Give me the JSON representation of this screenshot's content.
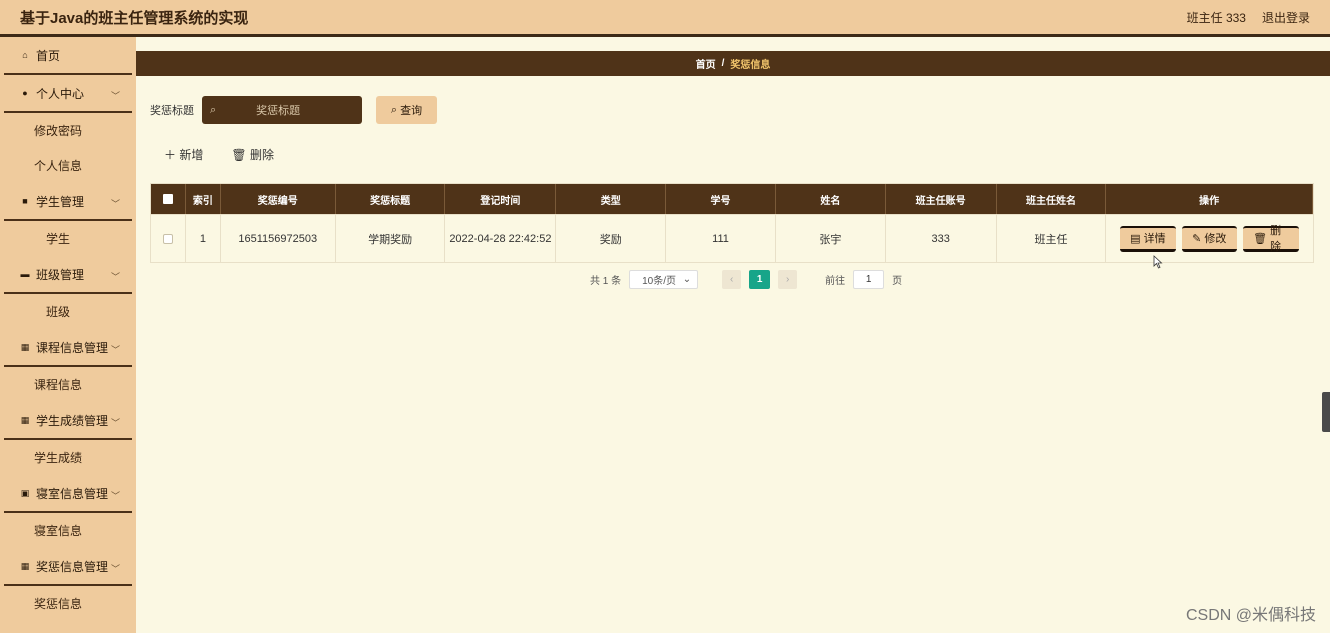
{
  "header": {
    "title": "基于Java的班主任管理系统的实现",
    "user": "班主任 333",
    "logout": "退出登录"
  },
  "sidebar": {
    "home": "首页",
    "groups": [
      {
        "label": "个人中心",
        "icon": "user-icon",
        "items": [
          "修改密码",
          "个人信息"
        ]
      },
      {
        "label": "学生管理",
        "icon": "book-icon",
        "items": [
          "学生"
        ]
      },
      {
        "label": "班级管理",
        "icon": "briefcase-icon",
        "items": [
          "班级"
        ]
      },
      {
        "label": "课程信息管理",
        "icon": "grid-icon",
        "items": [
          "课程信息"
        ]
      },
      {
        "label": "学生成绩管理",
        "icon": "grid-icon",
        "items": [
          "学生成绩"
        ]
      },
      {
        "label": "寝室信息管理",
        "icon": "clipboard-icon",
        "items": [
          "寝室信息"
        ]
      },
      {
        "label": "奖惩信息管理",
        "icon": "grid-icon",
        "items": [
          "奖惩信息"
        ]
      }
    ]
  },
  "breadcrumb": {
    "home": "首页",
    "sep": "/",
    "current": "奖惩信息"
  },
  "search": {
    "label": "奖惩标题",
    "placeholder": "奖惩标题",
    "button": "查询"
  },
  "actions": {
    "add": "新增",
    "delete": "删除"
  },
  "table": {
    "columns": [
      "索引",
      "奖惩编号",
      "奖惩标题",
      "登记时间",
      "类型",
      "学号",
      "姓名",
      "班主任账号",
      "班主任姓名",
      "操作"
    ],
    "rows": [
      {
        "index": "1",
        "no": "1651156972503",
        "title": "学期奖励",
        "time": "2022-04-28 22:42:52",
        "type": "奖励",
        "student_id": "111",
        "name": "张宇",
        "teacher_account": "333",
        "teacher_name": "班主任"
      }
    ],
    "ops": {
      "detail": "详情",
      "edit": "修改",
      "delete": "删除"
    }
  },
  "pagination": {
    "total": "共 1 条",
    "page_size": "10条/页",
    "current": "1",
    "goto_label": "前往",
    "goto_value": "1",
    "page_suffix": "页"
  },
  "watermark": "CSDN @米偶科技",
  "colors": {
    "sidebar": "#efcb9d",
    "dark": "#4f3318",
    "background": "#fbf8e3",
    "active_page": "#17a589",
    "crumb_active": "#f1c46b"
  }
}
